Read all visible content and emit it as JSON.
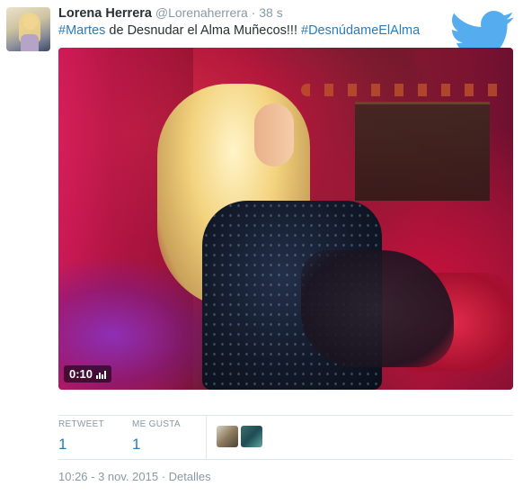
{
  "tweet": {
    "fullname": "Lorena Herrera",
    "handle": "@Lorenaherrera",
    "separator": "·",
    "time_ago": "38 s",
    "text_parts": {
      "hashtag1": "#Martes",
      "middle": " de Desnudar el Alma Muñecos!!! ",
      "hashtag2": "#DesnúdameElAlma"
    },
    "hashtag_color": "#2b7bb9"
  },
  "media": {
    "duration": "0:10",
    "type": "video"
  },
  "stats": {
    "retweet_label": "RETWEET",
    "retweet_count": "1",
    "like_label": "ME GUSTA",
    "like_count": "1"
  },
  "footer": {
    "timestamp": "10:26 - 3 nov. 2015",
    "separator": "·",
    "details_link": "Detalles"
  },
  "icons": {
    "brand": "twitter-bird-icon",
    "brand_color": "#55acee"
  }
}
